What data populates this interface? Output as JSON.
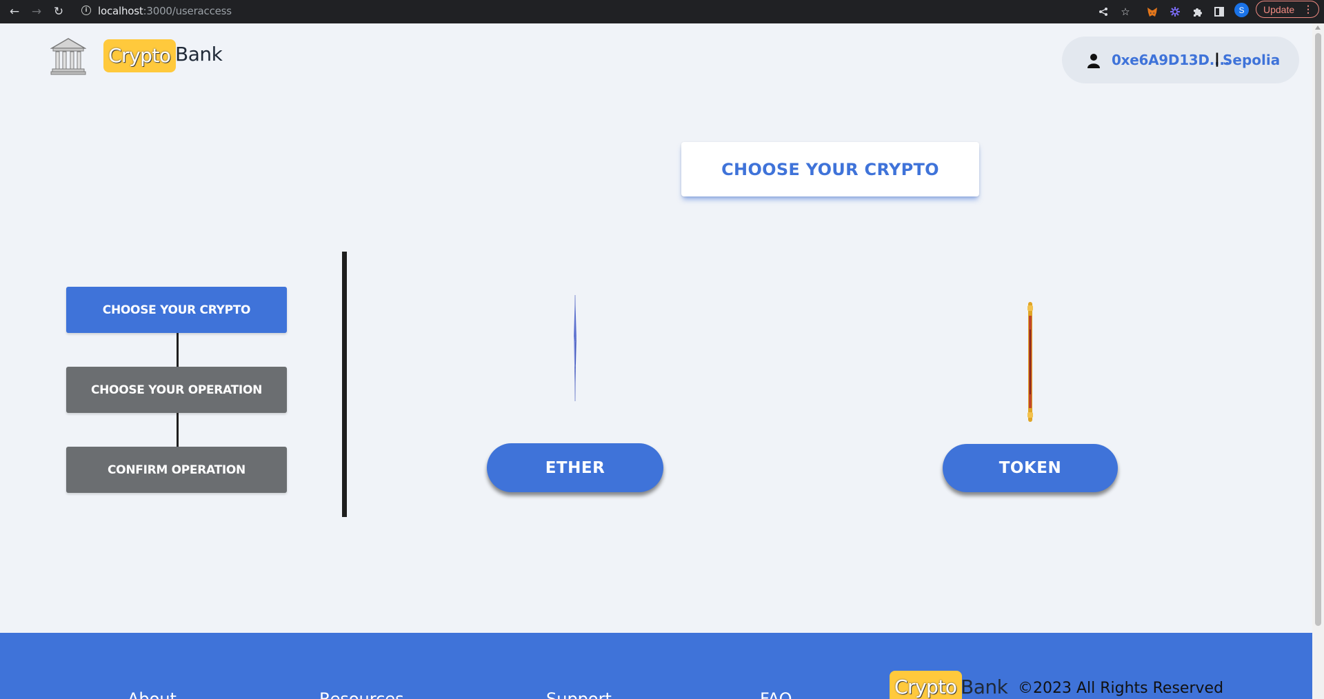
{
  "browser": {
    "url_host": "localhost",
    "url_path": ":3000/useraccess",
    "profile_initial": "S",
    "update_label": "Update",
    "update_menu": "⋮",
    "icons": [
      "back-icon",
      "forward-icon",
      "reload-icon",
      "site-info-icon",
      "share-icon",
      "bookmark-star-icon",
      "metamask-fox-icon",
      "extension-icon",
      "puzzle-icon",
      "side-panel-icon"
    ]
  },
  "header": {
    "logo_crypto": "Crypto",
    "logo_bank": "Bank",
    "account_address": "0xe6A9D13D....",
    "separator": "|",
    "network": "Sepolia"
  },
  "page_title": "CHOOSE YOUR CRYPTO",
  "steps": [
    {
      "label": "CHOOSE YOUR CRYPTO",
      "state": "active"
    },
    {
      "label": "CHOOSE YOUR OPERATION",
      "state": "inactive"
    },
    {
      "label": "CONFIRM OPERATION",
      "state": "inactive"
    }
  ],
  "options": [
    {
      "label": "ETHER",
      "icon": "ether-coin-icon"
    },
    {
      "label": "TOKEN",
      "icon": "token-coin-icon"
    }
  ],
  "footer": {
    "links": [
      "About",
      "Resources",
      "Support",
      "FAQ"
    ],
    "logo_crypto": "Crypto",
    "logo_bank": "Bank",
    "copyright": "©2023 All Rights Reserved"
  },
  "colors": {
    "primary": "#3f73d9",
    "inactive": "#6b6e71",
    "logo_yellow": "#ffc93c",
    "background": "#f0f3f8"
  }
}
